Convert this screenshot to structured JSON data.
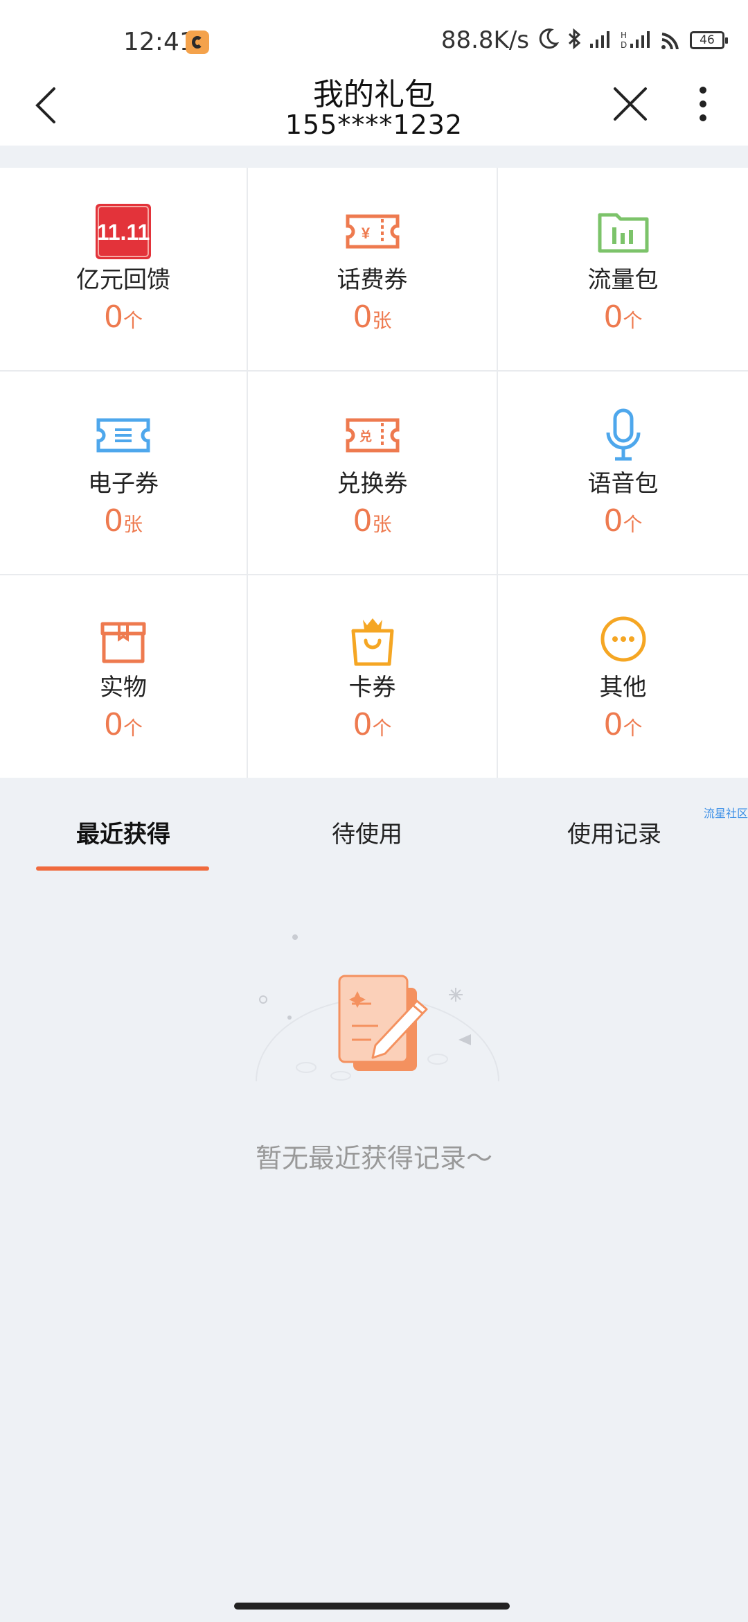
{
  "status_bar": {
    "time": "12:41",
    "network_speed": "88.8K/s",
    "battery": "46"
  },
  "header": {
    "title": "我的礼包",
    "phone": "155****1232"
  },
  "grid": [
    {
      "label": "亿元回馈",
      "count": "0",
      "unit": "个",
      "icon": "promo-1111-icon",
      "icon_text": "11.11"
    },
    {
      "label": "话费券",
      "count": "0",
      "unit": "张",
      "icon": "bill-coupon-icon"
    },
    {
      "label": "流量包",
      "count": "0",
      "unit": "个",
      "icon": "data-package-icon"
    },
    {
      "label": "电子券",
      "count": "0",
      "unit": "张",
      "icon": "e-coupon-icon"
    },
    {
      "label": "兑换券",
      "count": "0",
      "unit": "张",
      "icon": "exchange-coupon-icon",
      "icon_text": "兑"
    },
    {
      "label": "语音包",
      "count": "0",
      "unit": "个",
      "icon": "microphone-icon"
    },
    {
      "label": "实物",
      "count": "0",
      "unit": "个",
      "icon": "gift-box-icon"
    },
    {
      "label": "卡券",
      "count": "0",
      "unit": "个",
      "icon": "card-bag-icon"
    },
    {
      "label": "其他",
      "count": "0",
      "unit": "个",
      "icon": "more-dots-icon"
    }
  ],
  "tabs": [
    {
      "label": "最近获得",
      "active": true
    },
    {
      "label": "待使用",
      "active": false
    },
    {
      "label": "使用记录",
      "active": false
    }
  ],
  "corner_link": "流星社区",
  "empty_text": "暂无最近获得记录～",
  "colors": {
    "accent": "#f06a3d",
    "count": "#ee7a4f",
    "background": "#eef1f5"
  }
}
